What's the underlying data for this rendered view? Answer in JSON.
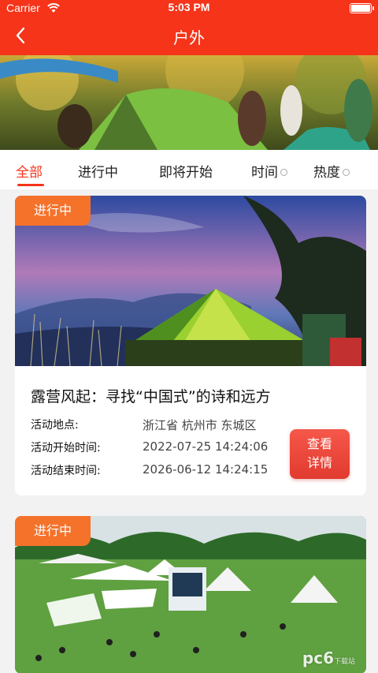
{
  "status_bar": {
    "carrier": "Carrier",
    "time": "5:03 PM"
  },
  "header": {
    "title": "户外"
  },
  "tabs": [
    {
      "label": "全部",
      "active": true
    },
    {
      "label": "进行中"
    },
    {
      "label": "即将开始"
    },
    {
      "label": "时间",
      "sortable": true
    },
    {
      "label": "热度",
      "sortable": true
    }
  ],
  "activities": [
    {
      "status": "进行中",
      "title": "露营风起：寻找“中国式”的诗和远方",
      "location_label": "活动地点:",
      "location": "浙江省 杭州市 东城区",
      "start_label": "活动开始时间:",
      "start_time": "2022-07-25 14:24:06",
      "end_label": "活动结束时间:",
      "end_time": "2026-06-12 14:24:15",
      "button_line1": "查看",
      "button_line2": "详情"
    },
    {
      "status": "进行中"
    }
  ],
  "watermark": {
    "brand": "pc6",
    "sub": "下载站"
  },
  "colors": {
    "primary": "#f5341a",
    "badge": "#f5722b",
    "button": "#e23a2f"
  }
}
